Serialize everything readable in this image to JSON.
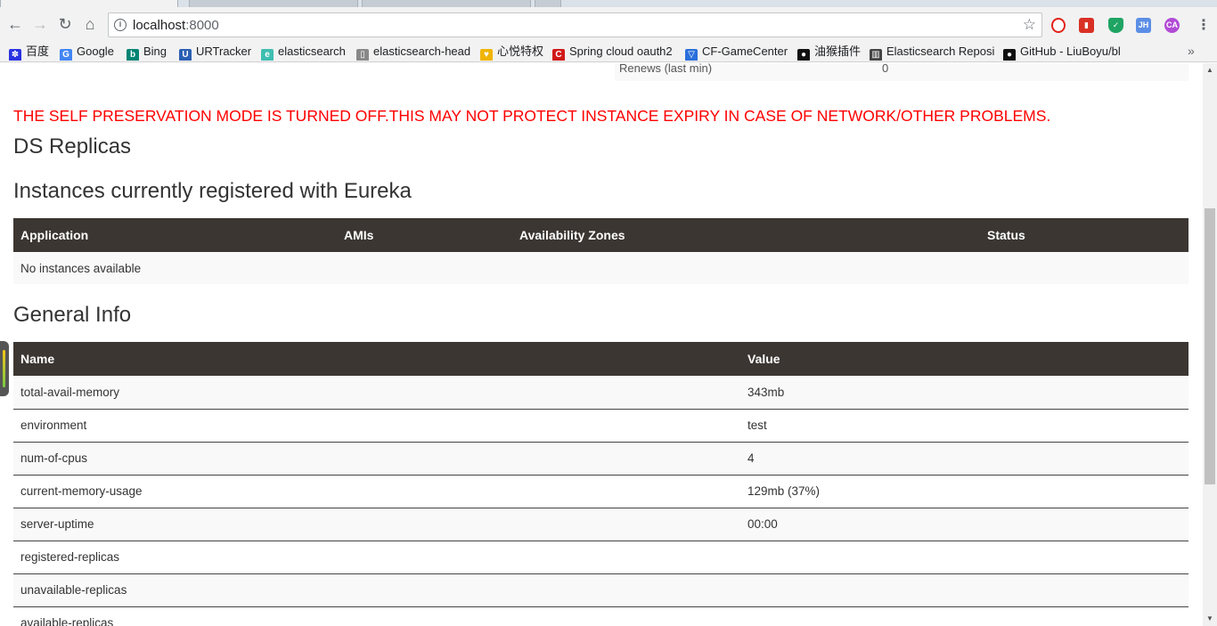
{
  "browser": {
    "url_host": "localhost",
    "url_port": ":8000",
    "bookmarks": [
      {
        "label": "百度",
        "icon": "baidu-paw-icon",
        "color": "#2932e1"
      },
      {
        "label": "Google",
        "icon": "google-g-icon",
        "color": "#4285f4"
      },
      {
        "label": "Bing",
        "icon": "bing-icon",
        "color": "#008373"
      },
      {
        "label": "URTracker",
        "icon": "urtracker-icon",
        "color": "#2b5fb4"
      },
      {
        "label": "elasticsearch",
        "icon": "elasticsearch-icon",
        "color": "#3ebeb0"
      },
      {
        "label": "elasticsearch-head",
        "icon": "page-icon",
        "color": "#888888"
      },
      {
        "label": "心悦特权",
        "icon": "heart-gem-icon",
        "color": "#f0b400"
      },
      {
        "label": "Spring cloud oauth2",
        "icon": "spring-c-icon",
        "color": "#d11919"
      },
      {
        "label": "CF-GameCenter",
        "icon": "shield-icon",
        "color": "#2a6fdb"
      },
      {
        "label": "油猴插件",
        "icon": "tampermonkey-icon",
        "color": "#111111"
      },
      {
        "label": "Elasticsearch Reposi",
        "icon": "book-icon",
        "color": "#444444"
      },
      {
        "label": "GitHub - LiuBoyu/bl",
        "icon": "github-icon",
        "color": "#111111"
      }
    ]
  },
  "page": {
    "prev_row": {
      "key": "Renews (last min)",
      "value": "0"
    },
    "warning": "THE SELF PRESERVATION MODE IS TURNED OFF.THIS MAY NOT PROTECT INSTANCE EXPIRY IN CASE OF NETWORK/OTHER PROBLEMS.",
    "ds_replicas_title": "DS Replicas",
    "instances_title": "Instances currently registered with Eureka",
    "instances_table": {
      "headers": [
        "Application",
        "AMIs",
        "Availability Zones",
        "Status"
      ],
      "empty_message": "No instances available"
    },
    "general_title": "General Info",
    "general_table": {
      "headers": [
        "Name",
        "Value"
      ],
      "rows": [
        {
          "name": "total-avail-memory",
          "value": "343mb"
        },
        {
          "name": "environment",
          "value": "test"
        },
        {
          "name": "num-of-cpus",
          "value": "4"
        },
        {
          "name": "current-memory-usage",
          "value": "129mb (37%)"
        },
        {
          "name": "server-uptime",
          "value": "00:00"
        },
        {
          "name": "registered-replicas",
          "value": ""
        },
        {
          "name": "unavailable-replicas",
          "value": ""
        },
        {
          "name": "available-replicas",
          "value": ""
        }
      ]
    }
  },
  "colors": {
    "warning": "#ff0000",
    "table_header_bg": "#3b3632"
  }
}
